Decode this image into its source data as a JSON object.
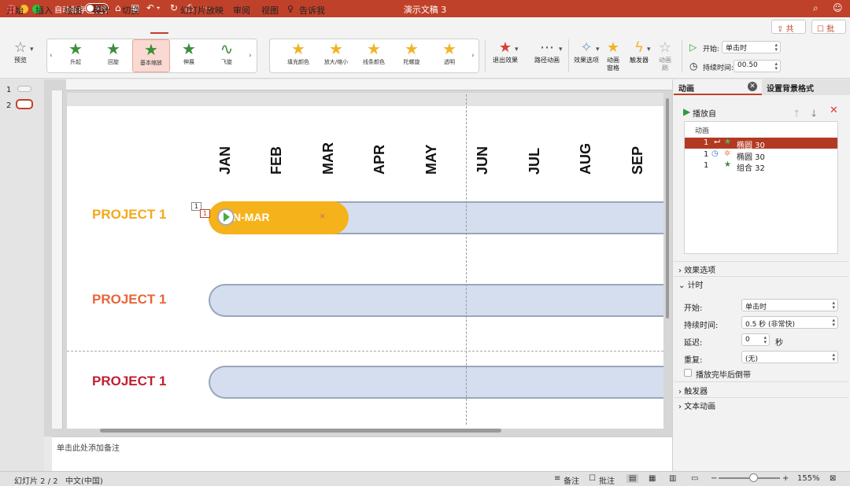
{
  "window": {
    "title": "演示文稿 3",
    "autosave_label": "自动保存",
    "autosave_state": "关闭"
  },
  "menu": {
    "tabs": [
      "开始",
      "插入",
      "绘图",
      "设计",
      "切换",
      "动画",
      "幻灯片放映",
      "审阅",
      "视图"
    ],
    "active_tab": "动画",
    "tell_me": "告诉我",
    "share": "共享",
    "comments": "批注"
  },
  "ribbon": {
    "preview": "预览",
    "entrance_gallery": [
      "升起",
      "回旋",
      "基本缩放",
      "伸展",
      "飞旋"
    ],
    "selected_effect": "基本缩放",
    "emphasis_gallery": [
      "填充颜色",
      "放大/缩小",
      "线条颜色",
      "陀螺旋",
      "透明"
    ],
    "exit_effects": "退出效果",
    "motion_paths": "路径动画",
    "effect_options": "效果选项",
    "animation_pane": "动画\n窗格",
    "trigger": "触发器",
    "animate_as": "动画\n刷",
    "start_label": "开始:",
    "start_value": "单击时",
    "duration_label": "持续时间:",
    "duration_value": "00.50"
  },
  "thumbnails": [
    "1",
    "2"
  ],
  "slide": {
    "months": [
      "JAN",
      "FEB",
      "MAR",
      "APR",
      "MAY",
      "JUN",
      "JUL",
      "AUG",
      "SEP"
    ],
    "projects": [
      {
        "label": "PROJECT 1",
        "color": "#f3a91a"
      },
      {
        "label": "PROJECT 1",
        "color": "#e8663a"
      },
      {
        "label": "PROJECT 1",
        "color": "#c0202f"
      }
    ],
    "bar_text": "N-MAR",
    "anim_tags": [
      "1",
      "1"
    ]
  },
  "notes_placeholder": "单击此处添加备注",
  "pane": {
    "tabs": [
      "动画",
      "设置背景格式"
    ],
    "play_from": "播放自",
    "list_header": "动画",
    "items": [
      {
        "num": "1",
        "name": "椭圆 30",
        "selected": true
      },
      {
        "num": "1",
        "name": "椭圆 30",
        "selected": false
      },
      {
        "num": "1",
        "name": "组合 32",
        "selected": false
      }
    ],
    "effect_options": "效果选项",
    "timing": "计时",
    "start_label": "开始:",
    "start_value": "单击时",
    "duration_label": "持续时间:",
    "duration_value": "0.5 秒 (非常快)",
    "delay_label": "延迟:",
    "delay_value": "0",
    "delay_unit": "秒",
    "repeat_label": "重复:",
    "repeat_value": "(无)",
    "rewind_label": "播放完毕后倒带",
    "triggers": "触发器",
    "text_animation": "文本动画"
  },
  "status": {
    "slide_info": "幻灯片 2 / 2",
    "language": "中文(中国)",
    "notes": "备注",
    "comments": "批注",
    "zoom": "155%"
  },
  "colors": {
    "accent": "#c0412a",
    "bar_fill": "#f6b21a",
    "track_fill": "#d4deee"
  }
}
